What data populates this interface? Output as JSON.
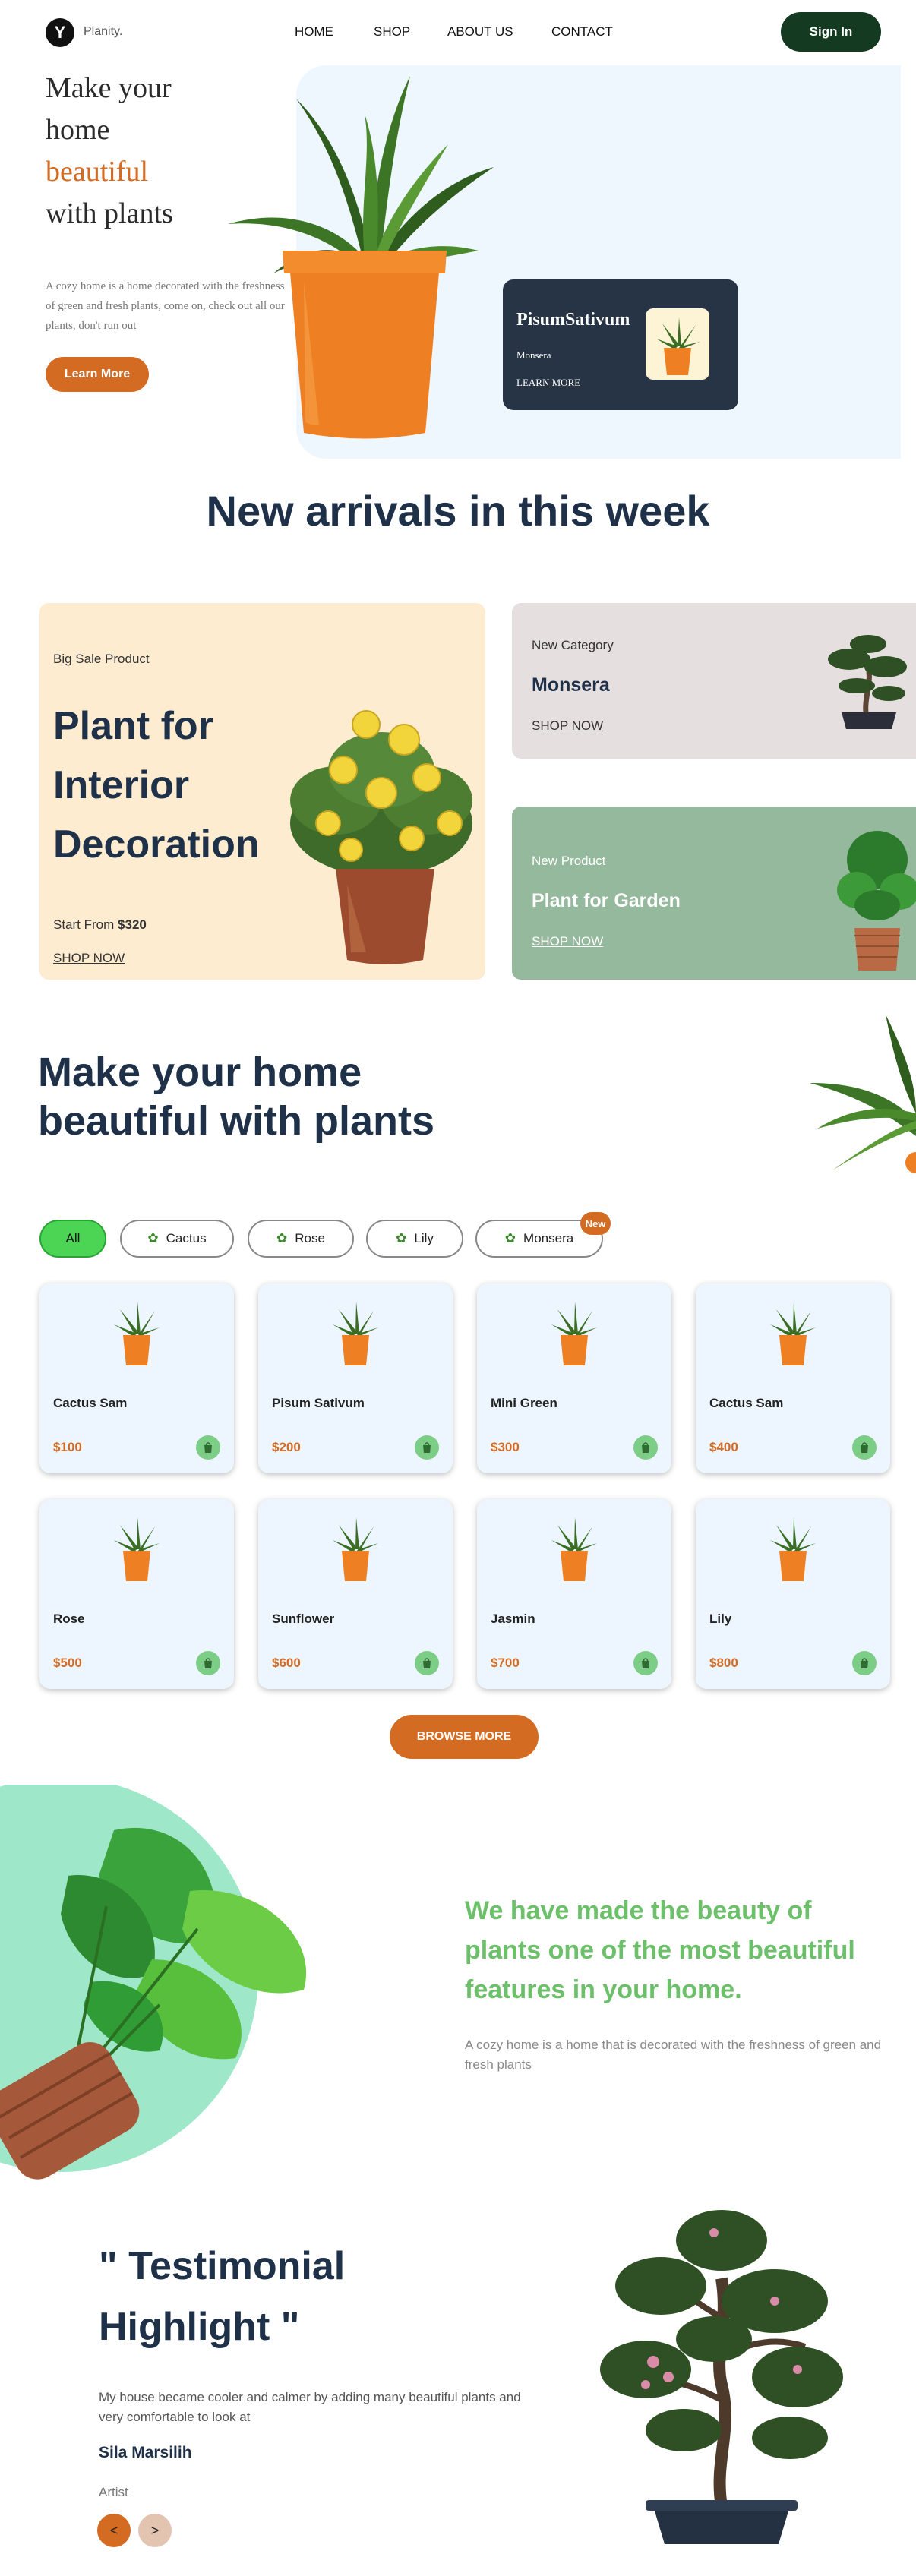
{
  "header": {
    "logo_letter": "Y",
    "brand": "Planity.",
    "nav": [
      "HOME",
      "SHOP",
      "ABOUT US",
      "CONTACT"
    ],
    "signin_label": "Sign In"
  },
  "hero": {
    "line1": "Make your",
    "line2": "home",
    "line3": "beautiful",
    "line4": "with plants",
    "description": "A cozy home is a home decorated with the freshness of green and fresh plants, come on, check out all our plants, don't run out",
    "cta_label": "Learn More",
    "card": {
      "title": "PisumSativum",
      "subtitle": "Monsera",
      "link": "LEARN MORE"
    }
  },
  "arrivals": {
    "title": "New arrivals in this week",
    "big_card": {
      "label": "Big Sale Product",
      "title_line1": "Plant for",
      "title_line2": "Interior",
      "title_line3": "Decoration",
      "price_prefix": "Start From",
      "price": "$320",
      "link": "SHOP NOW"
    },
    "monsera_card": {
      "label": "New Category",
      "title": "Monsera",
      "link": "SHOP NOW"
    },
    "garden_card": {
      "label": "New Product",
      "title": "Plant for Garden",
      "link": "SHOP NOW"
    }
  },
  "products": {
    "title_line1": "Make your home",
    "title_line2": "beautiful with plants",
    "filters": [
      "All",
      "Cactus",
      "Rose",
      "Lily",
      "Monsera"
    ],
    "new_badge": "New",
    "items": [
      {
        "name": "Cactus Sam",
        "price": "$100"
      },
      {
        "name": "Pisum Sativum",
        "price": "$200"
      },
      {
        "name": "Mini Green",
        "price": "$300"
      },
      {
        "name": "Cactus Sam",
        "price": "$400"
      },
      {
        "name": "Rose",
        "price": "$500"
      },
      {
        "name": "Sunflower",
        "price": "$600"
      },
      {
        "name": "Jasmin",
        "price": "$700"
      },
      {
        "name": "Lily",
        "price": "$800"
      }
    ],
    "browse_label": "BROWSE MORE"
  },
  "beauty": {
    "line1": "We have made the beauty of",
    "line2": "plants one of the most beautiful",
    "line3": "features in your home.",
    "description": "A cozy home is a home that is decorated with the freshness of green and fresh plants"
  },
  "testimonial": {
    "title_line1": "\" Testimonial",
    "title_line2": "Highlight \"",
    "quote": "My house became cooler and calmer by adding many beautiful plants and very comfortable to look at",
    "name": "Sila Marsilih",
    "role": "Artist",
    "prev": "<",
    "next": ">"
  },
  "colors": {
    "accent": "#d36b23",
    "navy": "#1f3148",
    "green": "#6cc06a",
    "dark_green": "#143a21"
  }
}
